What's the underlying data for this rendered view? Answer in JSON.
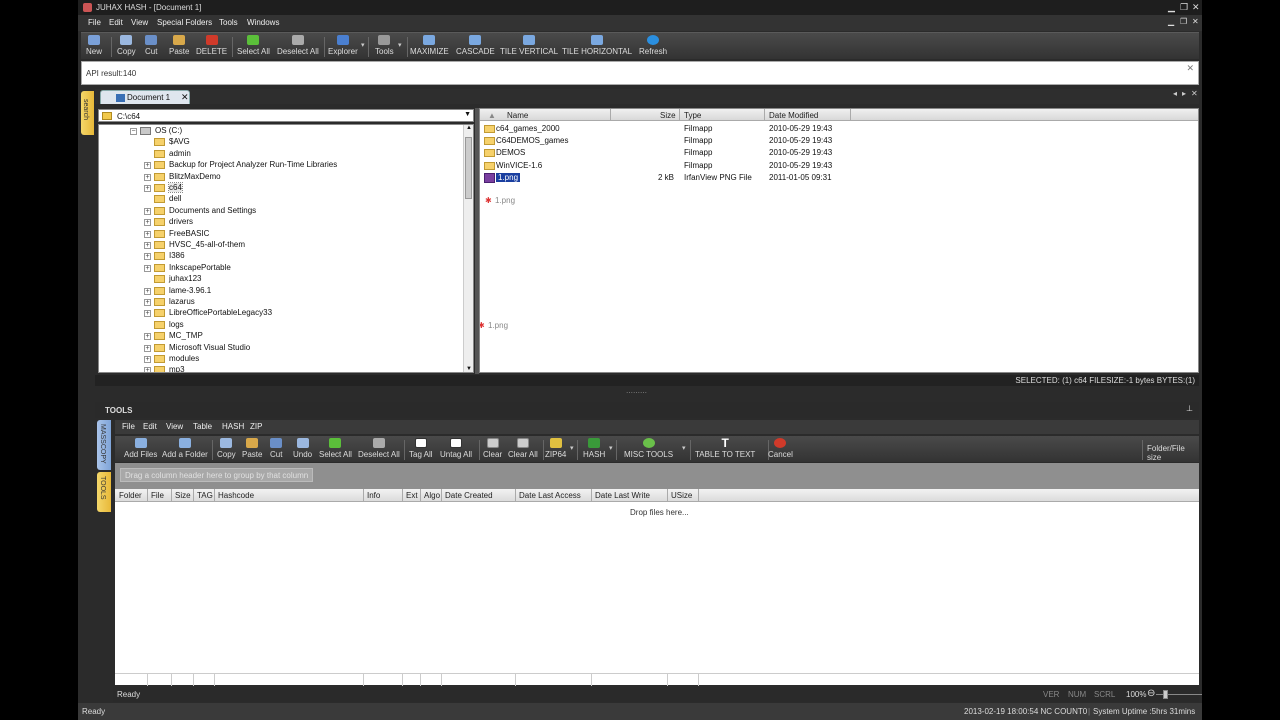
{
  "window": {
    "title": "JUHAX HASH - [Document 1]"
  },
  "menu": [
    "File",
    "Edit",
    "View",
    "Special Folders",
    "Tools",
    "Windows"
  ],
  "toolbar": [
    "New",
    "Copy",
    "Cut",
    "Paste",
    "DELETE",
    "Select All",
    "Deselect All",
    "Explorer",
    "Tools",
    "MAXIMIZE",
    "CASCADE",
    "TILE VERTICAL",
    "TILE HORIZONTAL",
    "Refresh"
  ],
  "api_result": "API result:140",
  "side_tab": "search",
  "doc_tab": "Document 1",
  "path": "C:\\c64",
  "tree": [
    {
      "label": "OS (C:)",
      "level": 0,
      "expanded": true
    },
    {
      "label": "$AVG",
      "level": 1,
      "expandable": false
    },
    {
      "label": "admin",
      "level": 1,
      "expandable": false
    },
    {
      "label": "Backup for Project Analyzer Run-Time Libraries",
      "level": 1,
      "expandable": true
    },
    {
      "label": "BlitzMaxDemo",
      "level": 1,
      "expandable": true
    },
    {
      "label": "c64",
      "level": 1,
      "expandable": true,
      "selected": true
    },
    {
      "label": "dell",
      "level": 1,
      "expandable": false
    },
    {
      "label": "Documents and Settings",
      "level": 1,
      "expandable": true
    },
    {
      "label": "drivers",
      "level": 1,
      "expandable": true
    },
    {
      "label": "FreeBASIC",
      "level": 1,
      "expandable": true
    },
    {
      "label": "HVSC_45-all-of-them",
      "level": 1,
      "expandable": true
    },
    {
      "label": "I386",
      "level": 1,
      "expandable": true
    },
    {
      "label": "InkscapePortable",
      "level": 1,
      "expandable": true
    },
    {
      "label": "juhax123",
      "level": 1,
      "expandable": false
    },
    {
      "label": "lame-3.96.1",
      "level": 1,
      "expandable": true
    },
    {
      "label": "lazarus",
      "level": 1,
      "expandable": true
    },
    {
      "label": "LibreOfficePortableLegacy33",
      "level": 1,
      "expandable": true
    },
    {
      "label": "logs",
      "level": 1,
      "expandable": false
    },
    {
      "label": "MC_TMP",
      "level": 1,
      "expandable": true
    },
    {
      "label": "Microsoft Visual Studio",
      "level": 1,
      "expandable": true
    },
    {
      "label": "modules",
      "level": 1,
      "expandable": true
    },
    {
      "label": "mp3",
      "level": 1,
      "expandable": true
    }
  ],
  "files": {
    "columns": [
      "Name",
      "Size",
      "Type",
      "Date Modified"
    ],
    "rows": [
      {
        "name": "c64_games_2000",
        "size": "",
        "type": "Filmapp",
        "date": "2010-05-29 19:43",
        "kind": "folder"
      },
      {
        "name": "C64DEMOS_games",
        "size": "",
        "type": "Filmapp",
        "date": "2010-05-29 19:43",
        "kind": "folder"
      },
      {
        "name": "DEMOS",
        "size": "",
        "type": "Filmapp",
        "date": "2010-05-29 19:43",
        "kind": "folder"
      },
      {
        "name": "WinVICE-1.6",
        "size": "",
        "type": "Filmapp",
        "date": "2010-05-29 19:43",
        "kind": "folder"
      },
      {
        "name": "1.png",
        "size": "2 kB",
        "type": "IrfanView PNG File",
        "date": "2011-01-05 09:31",
        "kind": "png",
        "selected": true
      }
    ],
    "drag_ghost_1": "1.png",
    "drag_ghost_2": "1.png"
  },
  "selection_status": "SELECTED: (1) c64 FILESIZE:-1 bytes BYTES:(1)",
  "tools": {
    "title": "TOOLS",
    "vtabs": [
      "MASSCOPY",
      "TOOLS"
    ],
    "menu": [
      "File",
      "Edit",
      "View",
      "Table",
      "HASH",
      "ZIP"
    ],
    "toolbar": [
      "Add Files",
      "Add a Folder",
      "Copy",
      "Paste",
      "Cut",
      "Undo",
      "Select All",
      "Deselect All",
      "Tag All",
      "Untag All",
      "Clear",
      "Clear All",
      "ZIP64",
      "HASH",
      "MISC TOOLS",
      "TABLE TO TEXT",
      "Cancel"
    ],
    "folder_file_size": "Folder/File size",
    "group_hint": "Drag a column header here to group by that column",
    "columns": [
      "Folder",
      "File",
      "Size",
      "TAG",
      "Hashcode",
      "Info",
      "Ext",
      "Algo",
      "Date Created",
      "Date Last Access",
      "Date Last Write",
      "USize"
    ],
    "drop_msg": "Drop files here..."
  },
  "inner_status": {
    "left": "Ready",
    "indicators": [
      "VER",
      "NUM",
      "SCRL"
    ],
    "zoom": "100%"
  },
  "outer_status": {
    "left": "Ready",
    "datetime": "2013-02-19 18:00:54 NC COUNT0",
    "uptime": "System Uptime :5hrs 31mins"
  }
}
